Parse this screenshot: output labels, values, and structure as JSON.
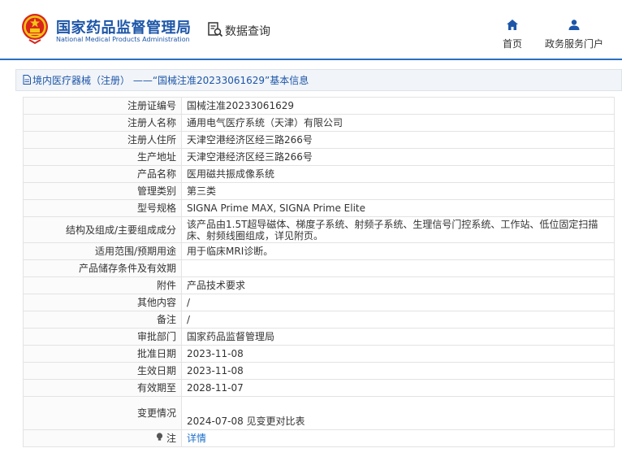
{
  "header": {
    "logo_cn": "国家药品监督管理局",
    "logo_en": "National Medical Products Administration",
    "query_label": "数据查询",
    "nav": [
      {
        "label": "首页",
        "icon": "home-icon"
      },
      {
        "label": "政务服务门户",
        "icon": "user-icon"
      }
    ]
  },
  "title": "境内医疗器械（注册） ——“国械注准20233061629”基本信息",
  "rows": [
    {
      "label": "注册证编号",
      "value": "国械注准20233061629"
    },
    {
      "label": "注册人名称",
      "value": "通用电气医疗系统（天津）有限公司"
    },
    {
      "label": "注册人住所",
      "value": "天津空港经济区经三路266号"
    },
    {
      "label": "生产地址",
      "value": "天津空港经济区经三路266号"
    },
    {
      "label": "产品名称",
      "value": "医用磁共振成像系统"
    },
    {
      "label": "管理类别",
      "value": "第三类"
    },
    {
      "label": "型号规格",
      "value": "SIGNA Prime MAX, SIGNA Prime Elite"
    },
    {
      "label": "结构及组成/主要组成成分",
      "value": "该产品由1.5T超导磁体、梯度子系统、射频子系统、生理信号门控系统、工作站、低位固定扫描床、射频线圈组成，详见附页。"
    },
    {
      "label": "适用范围/预期用途",
      "value": "用于临床MRI诊断。"
    },
    {
      "label": "产品储存条件及有效期",
      "value": ""
    },
    {
      "label": "附件",
      "value": "产品技术要求"
    },
    {
      "label": "其他内容",
      "value": "/"
    },
    {
      "label": "备注",
      "value": "/"
    },
    {
      "label": "审批部门",
      "value": "国家药品监督管理局"
    },
    {
      "label": "批准日期",
      "value": "2023-11-08"
    },
    {
      "label": "生效日期",
      "value": "2023-11-08"
    },
    {
      "label": "有效期至",
      "value": "2028-11-07"
    }
  ],
  "change": {
    "label": "变更情况",
    "value": "2024-07-08 见变更对比表"
  },
  "note": {
    "label": "注",
    "link": "详情",
    "icon": "lightbulb-icon"
  }
}
